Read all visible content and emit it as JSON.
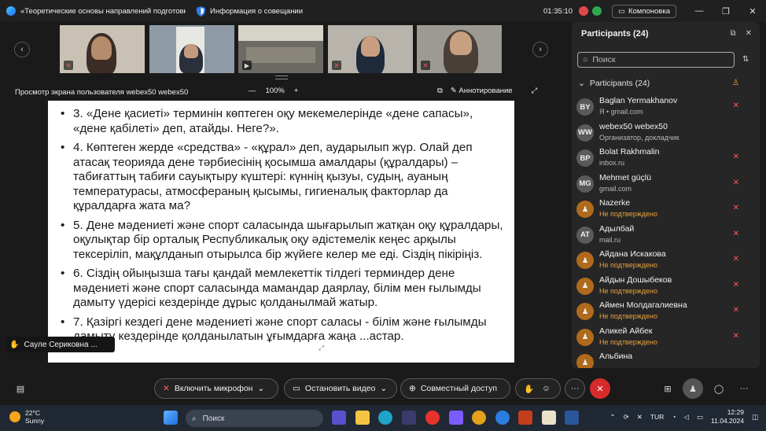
{
  "titlebar": {
    "meeting_title": "«Теоретические основы направлений подготовк...",
    "info_label": "Информация о совещании",
    "timer": "01:35:10",
    "compact_label": "Компоновка"
  },
  "share": {
    "label": "Просмотр экрана пользователя webex50 webex50",
    "zoom": "100%",
    "annotate_label": "Аннотирование"
  },
  "slide": {
    "items": [
      "3. «Дене қасиеті» терминін көптеген оқу мекемелерінде «дене сапасы», «дене қабілеті» деп, атайды. Неге?».",
      "4. Көптеген жерде «средства» - «құрал» деп, аударылып жүр. Олай деп атасақ теорияда дене тәрбиесінің қосымша амалдары (құралдары) – табиғаттың табиғи сауықтыру күштері: күннің қызуы, судың, ауаның температурасы, атмосфераның қысымы, гигиеналық факторлар да құралдарға жата ма?",
      "5. Дене мәдениеті және спорт саласында шығарылып жатқан оқу құралдары, оқулықтар бір орталық Республикалық оқу әдістемелік кеңес арқылы тексеріліп, мақұлданып отырылса бір жүйеге келер ме еді. Сіздің пікіріңіз.",
      "6. Сіздің ойыңызша тағы қандай мемлекеттік тілдегі терминдер дене мәдениеті және спорт саласында мамандар даярлау, білім мен ғылымды дамыту үдерісі кездерінде дұрыс қолданылмай жатыр.",
      "7. Қазіргі кездегі дене мәдениеті және спорт саласы - білім және ғылымды дамыту кездерінде қолданылатын ұғымдарға жаңа ...астар."
    ]
  },
  "speaker_tag": "Сауле Сериковна ...",
  "participants": {
    "title": "Participants (24)",
    "search_placeholder": "Поиск",
    "section_label": "Participants (24)",
    "list": [
      {
        "initials": "BY",
        "name": "Baglan Yermakhanov",
        "sub": "Я • gmail.com",
        "status": "normal"
      },
      {
        "initials": "WW",
        "name": "webex50 webex50",
        "sub": "Организатор, докладчик",
        "status": "normal"
      },
      {
        "initials": "BP",
        "name": "Bolat Rakhmalin",
        "sub": "inbox.ru",
        "status": "normal"
      },
      {
        "initials": "MG",
        "name": "Mehmet güçlü",
        "sub": "gmail.com",
        "status": "normal"
      },
      {
        "initials": "",
        "name": "Nazerke",
        "sub": "Не подтверждено",
        "status": "unverified"
      },
      {
        "initials": "AT",
        "name": "Адылбай",
        "sub": "mail.ru",
        "status": "normal"
      },
      {
        "initials": "",
        "name": "Айдана Искакова",
        "sub": "Не подтверждено",
        "status": "unverified"
      },
      {
        "initials": "",
        "name": "Айдын Дошыбеков",
        "sub": "Не подтверждено",
        "status": "unverified"
      },
      {
        "initials": "",
        "name": "Аймен Молдагалиевна",
        "sub": "Не подтверждено",
        "status": "unverified"
      },
      {
        "initials": "",
        "name": "Аликей Айбек",
        "sub": "Не подтверждено",
        "status": "unverified"
      },
      {
        "initials": "",
        "name": "Альбина",
        "sub": "",
        "status": "unverified"
      }
    ]
  },
  "controls": {
    "mic_label": "Включить микрофон",
    "video_label": "Остановить видео",
    "share_label": "Совместный доступ"
  },
  "taskbar": {
    "temperature": "22°C",
    "weather": "Sunny",
    "search_label": "Поиск",
    "language": "TUR",
    "time": "12:29",
    "date": "11.04.2024"
  },
  "colors": {
    "accent_red": "#d62b2b",
    "unverified_orange": "#e8a23a"
  }
}
